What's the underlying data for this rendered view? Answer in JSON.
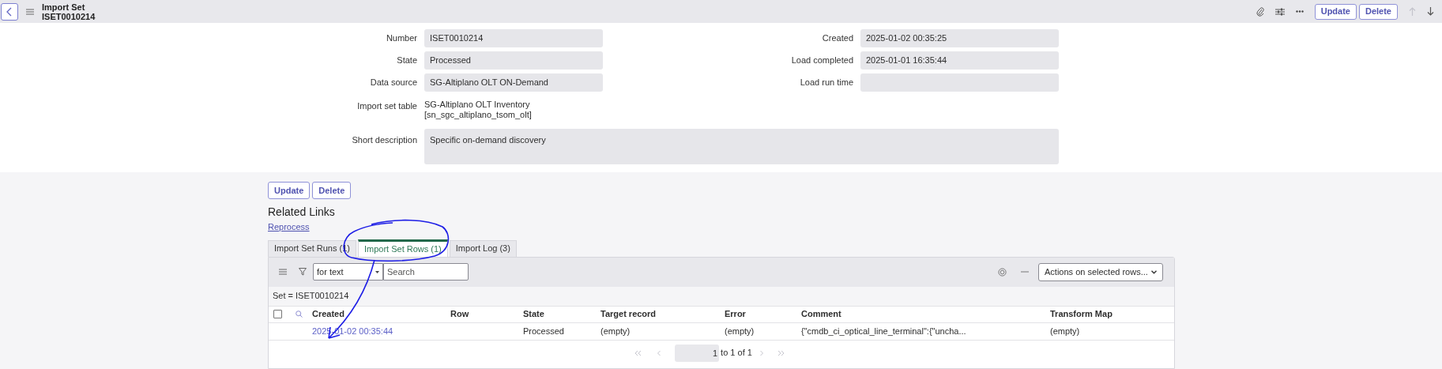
{
  "header": {
    "title": "Import Set",
    "subtitle": "ISET0010214",
    "buttons": [
      "Update",
      "Delete"
    ]
  },
  "form": {
    "rows": [
      {
        "left": {
          "label": "Number",
          "value": "ISET0010214"
        },
        "right": {
          "label": "Created",
          "value": "2025-01-02 00:35:25"
        }
      },
      {
        "left": {
          "label": "State",
          "value": "Processed"
        },
        "right": {
          "label": "Load completed",
          "value": "2025-01-01 16:35:44"
        }
      },
      {
        "left": {
          "label": "Data source",
          "value": "SG-Altiplano OLT ON-Demand"
        },
        "right": {
          "label": "Load run time"
        }
      }
    ],
    "table_field": {
      "label": "Import set table",
      "lines": [
        "SG-Altiplano OLT Inventory",
        "[sn_sgc_altiplano_tsom_olt]"
      ]
    },
    "short_description": {
      "label": "Short description",
      "value": "Specific on-demand discovery"
    }
  },
  "buttons": [
    "Update",
    "Delete"
  ],
  "related_links": {
    "title": "Related Links",
    "links": [
      "Reprocess"
    ]
  },
  "tabs": [
    {
      "label": "Import Set Runs (1)",
      "selected": false
    },
    {
      "label": "Import Set Rows (1)",
      "selected": true
    },
    {
      "label": "Import Log (3)",
      "selected": false
    }
  ],
  "list": {
    "search_select": "for text",
    "search_placeholder": "Search",
    "actions_select": "Actions on selected rows...",
    "breadcrumb": "Set = ISET0010214",
    "select_all": {
      "checked": false
    },
    "columns": [
      "Created",
      "Row",
      "State",
      "Target record",
      "Error",
      "Comment",
      "Transform Map"
    ],
    "rows": [
      {
        "created": "2025-01-02 00:35:44",
        "state": "Processed",
        "target_record": "(empty)",
        "error": "(empty)",
        "comment": "{\"cmdb_ci_optical_line_terminal\":{\"uncha...",
        "transform_map": "(empty)"
      }
    ],
    "pagination": {
      "page": "1",
      "text": "to 1 of 1"
    }
  }
}
